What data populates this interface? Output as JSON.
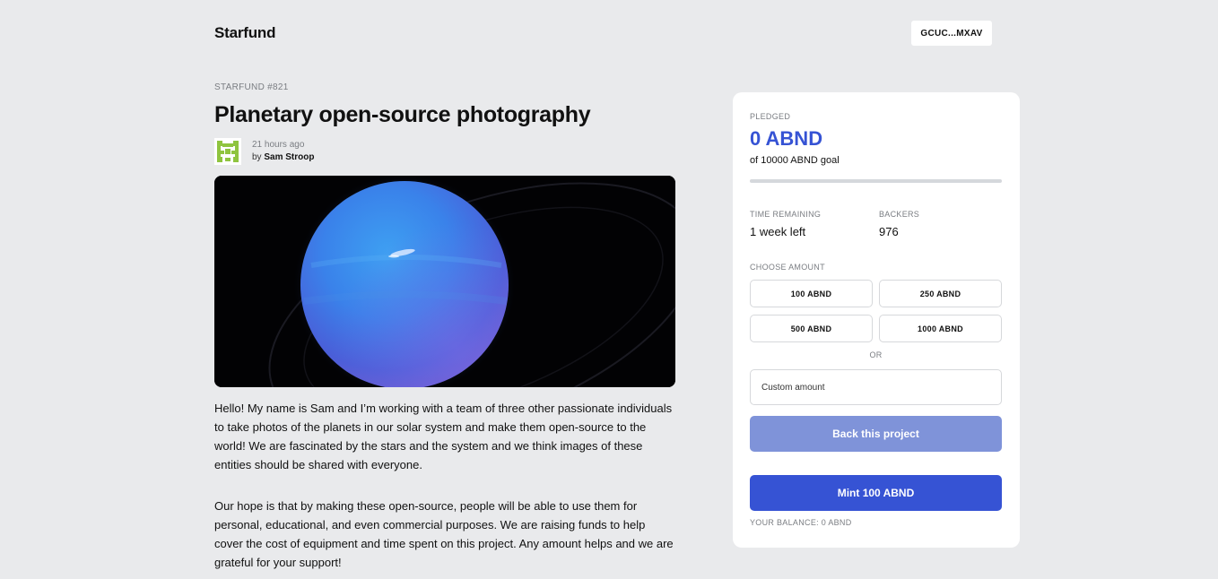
{
  "header": {
    "brand": "Starfund",
    "wallet_address": "GCUC...MXAV"
  },
  "project": {
    "id_label": "STARFUND #821",
    "title": "Planetary open-source photography",
    "posted_ago": "21 hours ago",
    "by_prefix": "by",
    "author": "Sam Stroop",
    "description": [
      "Hello! My name is Sam and I’m working with a team of three other passionate individuals to take photos of the planets in our solar system and make them open-source to the world! We are fascinated by the stars and the system and we think images of these entities should be shared with everyone.",
      "Our hope is that by making these open-source, people will be able to use them for personal, educational, and even commercial purposes. We are raising funds to help cover the cost of equipment and time spent on this project. Any amount helps and we are grateful for your support!"
    ]
  },
  "funding": {
    "pledged_label": "PLEDGED",
    "pledged_value": "0 ABND",
    "goal_text": "of 10000 ABND goal",
    "progress_fraction": 0,
    "time_remaining_label": "TIME REMAINING",
    "time_remaining_value": "1 week left",
    "backers_label": "BACKERS",
    "backers_value": "976",
    "choose_amount_label": "CHOOSE AMOUNT",
    "amounts": [
      "100 ABND",
      "250 ABND",
      "500 ABND",
      "1000 ABND"
    ],
    "or_label": "OR",
    "custom_amount_placeholder": "Custom amount",
    "back_button_label": "Back this project",
    "mint_button_label": "Mint 100 ABND",
    "balance_text": "YOUR BALANCE: 0 ABND"
  },
  "colors": {
    "accent": "#3653d4",
    "accent_disabled": "#7f93d9",
    "background": "#e9eaec",
    "avatar": "#8fc43f"
  }
}
